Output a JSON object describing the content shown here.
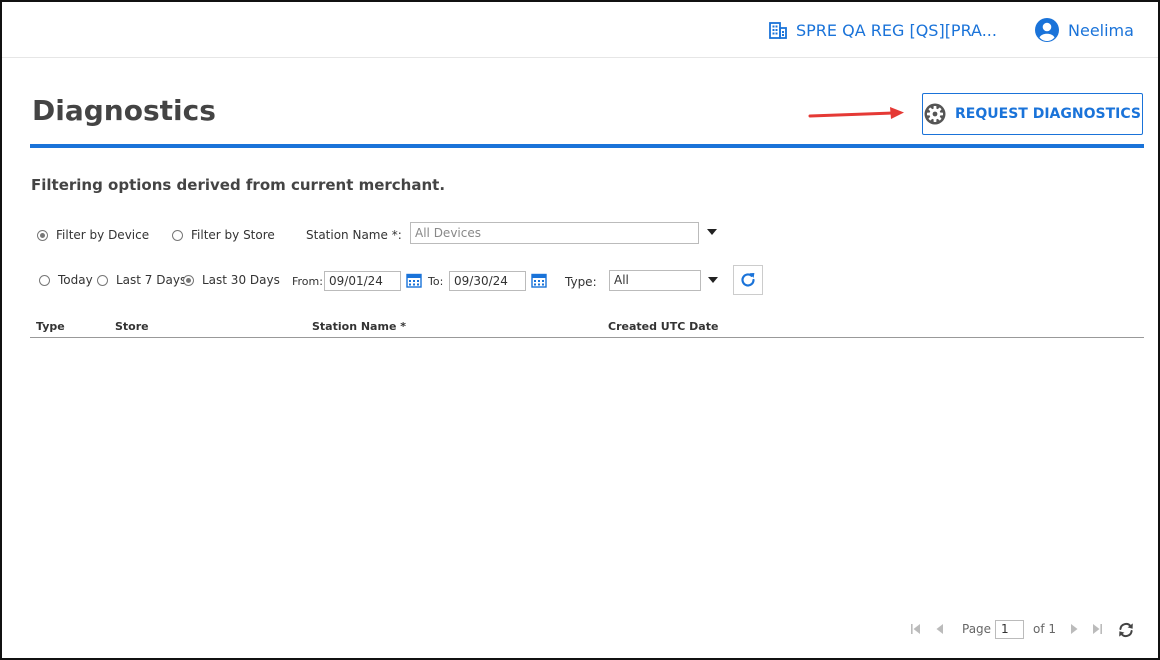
{
  "header": {
    "merchant": "SPRE QA REG [QS][PRA...",
    "user": "Neelima"
  },
  "page": {
    "title": "Diagnostics",
    "request_button": "REQUEST DIAGNOSTICS",
    "subtitle": "Filtering options derived from current merchant."
  },
  "filters": {
    "by_device": "Filter by Device",
    "by_store": "Filter by Store",
    "selected_filter": "Filter by Device",
    "station_label": "Station Name *:",
    "station_placeholder": "All Devices",
    "ranges": [
      "Today",
      "Last 7 Days",
      "Last 30 Days"
    ],
    "selected_range": "Last 30 Days",
    "from_label": "From:",
    "from_value": "09/01/24",
    "to_label": "To:",
    "to_value": "09/30/24",
    "type_label": "Type:",
    "type_value": "All"
  },
  "table": {
    "columns": [
      "Type",
      "Store",
      "Station Name *",
      "Created UTC Date"
    ],
    "rows": []
  },
  "pagination": {
    "page_label": "Page",
    "page_value": "1",
    "of_label": "of 1"
  },
  "colors": {
    "accent": "#1a73d9",
    "annotation_arrow": "#e53935"
  },
  "icons": {
    "merchant": "building-icon",
    "user": "user-circle-icon",
    "request": "gear-icon",
    "calendar": "calendar-icon",
    "refresh": "refresh-icon"
  }
}
